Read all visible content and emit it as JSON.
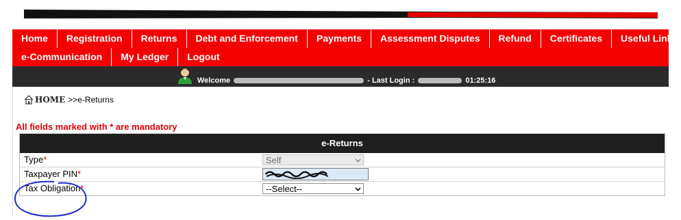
{
  "nav": {
    "items": [
      "Home",
      "Registration",
      "Returns",
      "Debt and Enforcement",
      "Payments",
      "Assessment Disputes",
      "Refund",
      "Certificates",
      "Useful Links"
    ],
    "items2": [
      "e-Communication",
      "My Ledger",
      "Logout"
    ]
  },
  "welcome": {
    "prefix": "Welcome",
    "last_login_label": "- Last Login :",
    "time": "01:25:16"
  },
  "breadcrumb": {
    "home": "HOME",
    "current": ">>e-Returns"
  },
  "mandatory_note": "All fields marked with * are mandatory",
  "form": {
    "title": "e-Returns",
    "type_label": "Type",
    "type_value": "Self",
    "pin_label": "Taxpayer PIN",
    "obligation_label": "Tax Obligation",
    "obligation_value": "--Select--",
    "required_mark": "*"
  },
  "colors": {
    "nav_bg": "#f40000",
    "welcome_bg": "#2b2b2b",
    "form_header_bg": "#1e1e1e",
    "required": "#e00000",
    "annotation": "#1a2bc8"
  },
  "icons": {
    "avatar": "user-avatar-icon",
    "home": "home-icon",
    "dropdown": "chevron-down-icon"
  }
}
